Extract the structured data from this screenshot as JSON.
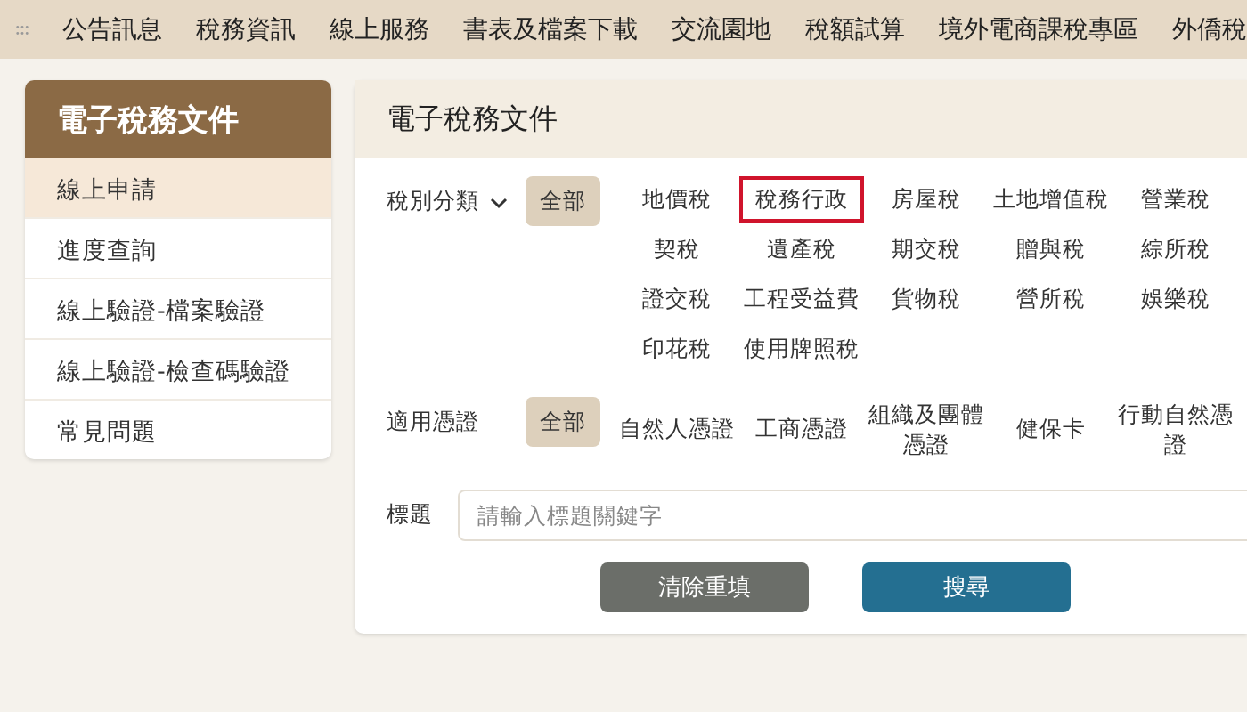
{
  "nav": {
    "items": [
      "公告訊息",
      "稅務資訊",
      "線上服務",
      "書表及檔案下載",
      "交流園地",
      "稅額試算",
      "境外電商課稅專區",
      "外僑稅"
    ]
  },
  "sidebar": {
    "title": "電子稅務文件",
    "items": [
      {
        "label": "線上申請",
        "selected": true
      },
      {
        "label": "進度查詢",
        "selected": false
      },
      {
        "label": "線上驗證-檔案驗證",
        "selected": false
      },
      {
        "label": "線上驗證-檢查碼驗證",
        "selected": false
      },
      {
        "label": "常見問題",
        "selected": false
      }
    ]
  },
  "main": {
    "title": "電子稅務文件",
    "filters": [
      {
        "label": "稅別分類",
        "dropdown": true,
        "options": [
          {
            "label": "全部",
            "selected": true,
            "highlighted": false
          },
          {
            "label": "地價稅",
            "selected": false,
            "highlighted": false
          },
          {
            "label": "稅務行政",
            "selected": false,
            "highlighted": true
          },
          {
            "label": "房屋稅",
            "selected": false,
            "highlighted": false
          },
          {
            "label": "土地增值稅",
            "selected": false,
            "highlighted": false
          },
          {
            "label": "營業稅",
            "selected": false,
            "highlighted": false
          },
          {
            "label": "契稅",
            "selected": false,
            "highlighted": false
          },
          {
            "label": "遺產稅",
            "selected": false,
            "highlighted": false
          },
          {
            "label": "期交稅",
            "selected": false,
            "highlighted": false
          },
          {
            "label": "贈與稅",
            "selected": false,
            "highlighted": false
          },
          {
            "label": "綜所稅",
            "selected": false,
            "highlighted": false
          },
          {
            "label": "證交稅",
            "selected": false,
            "highlighted": false
          },
          {
            "label": "工程受益費",
            "selected": false,
            "highlighted": false
          },
          {
            "label": "貨物稅",
            "selected": false,
            "highlighted": false
          },
          {
            "label": "營所稅",
            "selected": false,
            "highlighted": false
          },
          {
            "label": "娛樂稅",
            "selected": false,
            "highlighted": false
          },
          {
            "label": "印花稅",
            "selected": false,
            "highlighted": false
          },
          {
            "label": "使用牌照稅",
            "selected": false,
            "highlighted": false
          }
        ]
      },
      {
        "label": "適用憑證",
        "dropdown": false,
        "options": [
          {
            "label": "全部",
            "selected": true,
            "highlighted": false
          },
          {
            "label": "自然人憑證",
            "selected": false,
            "highlighted": false
          },
          {
            "label": "工商憑證",
            "selected": false,
            "highlighted": false
          },
          {
            "label": "組織及團體憑證",
            "selected": false,
            "highlighted": false
          },
          {
            "label": "健保卡",
            "selected": false,
            "highlighted": false
          },
          {
            "label": "行動自然憑證",
            "selected": false,
            "highlighted": false
          }
        ]
      }
    ],
    "title_field": {
      "label": "標題",
      "placeholder": "請輸入標題關鍵字"
    },
    "buttons": [
      {
        "label": "清除重填",
        "kind": "reset"
      },
      {
        "label": "搜尋",
        "kind": "search"
      }
    ]
  }
}
